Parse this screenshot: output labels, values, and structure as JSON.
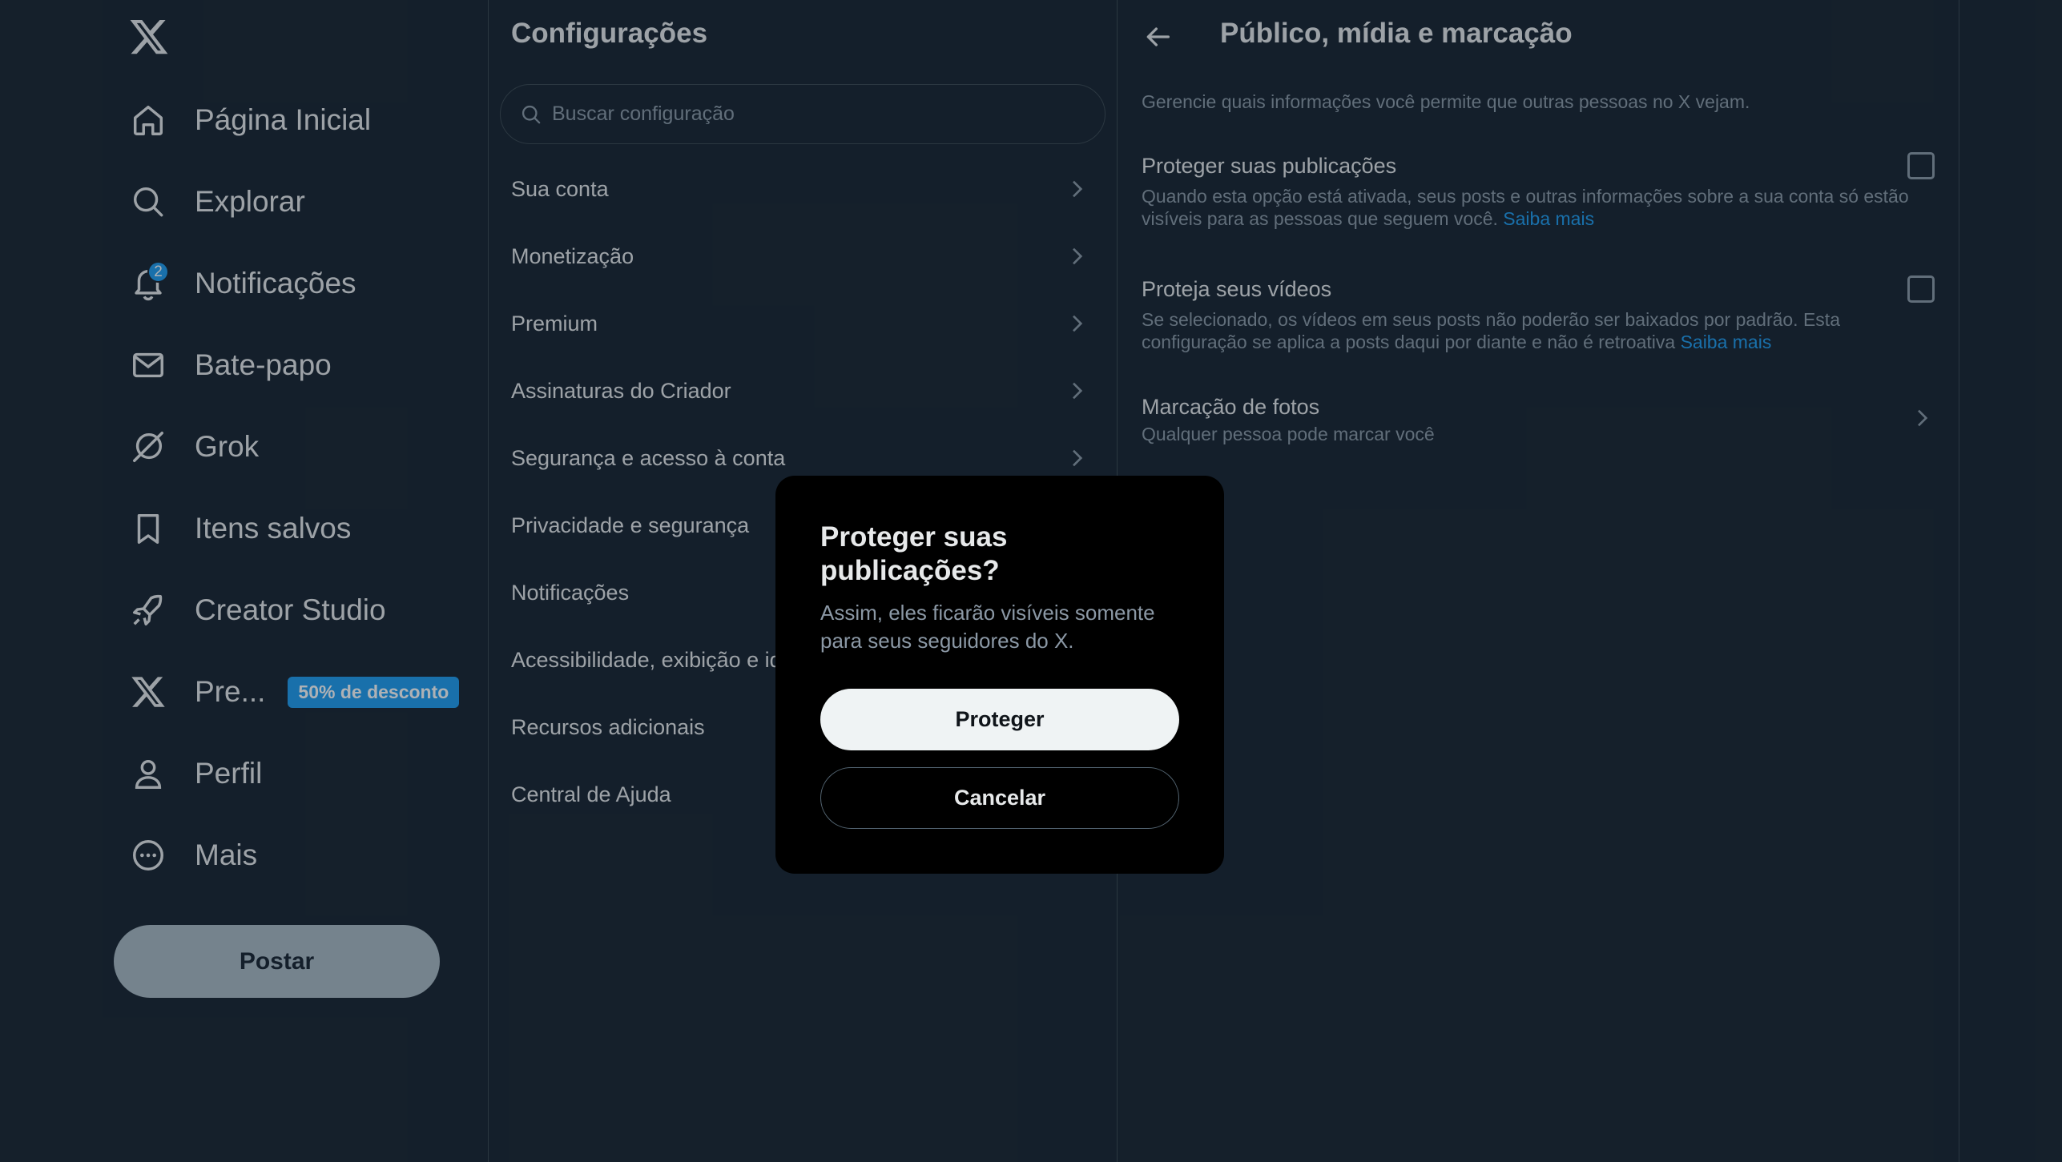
{
  "colors": {
    "background": "#15202b",
    "accent": "#1d9bf0",
    "border": "#38444d",
    "text_primary": "#e7e9ea",
    "text_secondary": "#8b98a5",
    "modal_bg": "#000000"
  },
  "nav": {
    "logo_icon": "x-logo-icon",
    "items": [
      {
        "icon": "home-icon",
        "label": "Página Inicial"
      },
      {
        "icon": "search-icon",
        "label": "Explorar"
      },
      {
        "icon": "bell-icon",
        "label": "Notificações",
        "badge": "2"
      },
      {
        "icon": "mail-icon",
        "label": "Bate-papo"
      },
      {
        "icon": "grok-icon",
        "label": "Grok"
      },
      {
        "icon": "bookmark-icon",
        "label": "Itens salvos"
      },
      {
        "icon": "rocket-icon",
        "label": "Creator Studio"
      },
      {
        "icon": "x-logo-icon",
        "label": "Pre...",
        "promo": "50% de desconto"
      },
      {
        "icon": "user-icon",
        "label": "Perfil"
      },
      {
        "icon": "more-icon",
        "label": "Mais"
      }
    ],
    "post_label": "Postar"
  },
  "settings": {
    "title": "Configurações",
    "search_placeholder": "Buscar configuração",
    "items": [
      {
        "label": "Sua conta"
      },
      {
        "label": "Monetização"
      },
      {
        "label": "Premium"
      },
      {
        "label": "Assinaturas do Criador"
      },
      {
        "label": "Segurança e acesso à conta"
      },
      {
        "label": "Privacidade e segurança"
      },
      {
        "label": "Notificações"
      },
      {
        "label": "Acessibilidade, exibição e idiomas"
      },
      {
        "label": "Recursos adicionais"
      },
      {
        "label": "Central de Ajuda"
      }
    ]
  },
  "detail": {
    "title": "Público, mídia e marcação",
    "description": "Gerencie quais informações você permite que outras pessoas no X vejam.",
    "protect_posts": {
      "title": "Proteger suas publicações",
      "text": "Quando esta opção está ativada, seus posts e outras informações sobre a sua conta só estão visíveis para as pessoas que seguem você.",
      "link": "Saiba mais",
      "checked": false
    },
    "protect_videos": {
      "title": "Proteja seus vídeos",
      "text": "Se selecionado, os vídeos em seus posts não poderão ser baixados por padrão. Esta configuração se aplica a posts daqui por diante e não é retroativa",
      "link": "Saiba mais",
      "checked": false
    },
    "photo_tagging": {
      "title": "Marcação de fotos",
      "subtitle": "Qualquer pessoa pode marcar você"
    }
  },
  "modal": {
    "title": "Proteger suas publicações?",
    "text": "Assim, eles ficarão visíveis somente para seus seguidores do X.",
    "confirm_label": "Proteger",
    "cancel_label": "Cancelar"
  }
}
